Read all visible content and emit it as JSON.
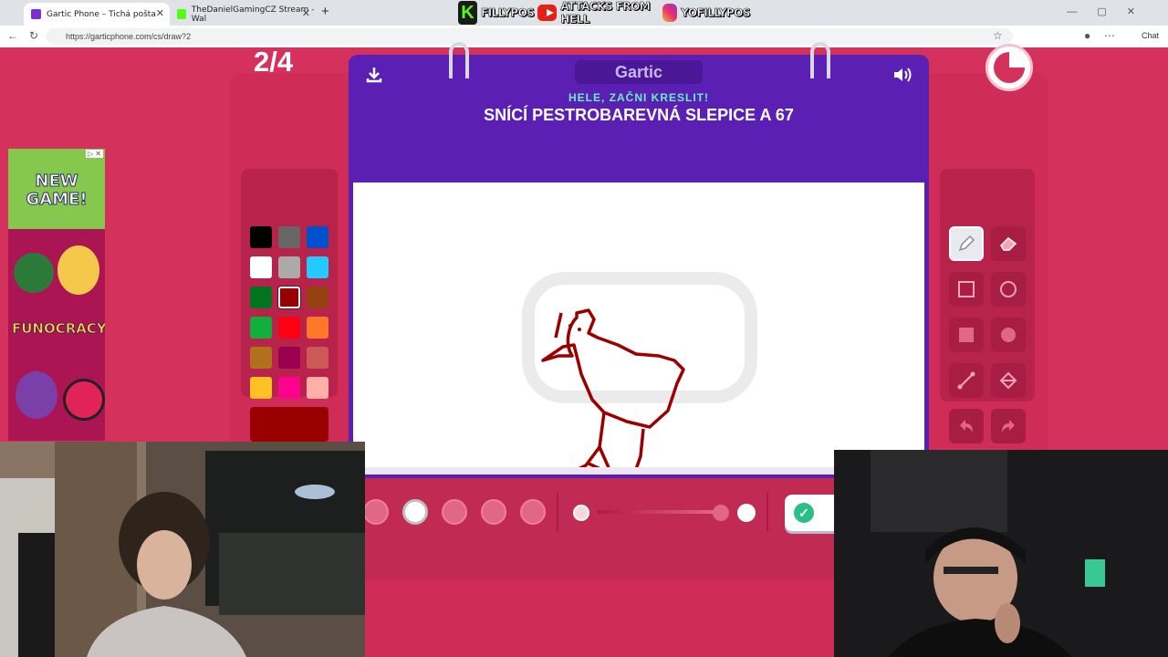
{
  "browser": {
    "tabs": [
      {
        "label": "Gartic Phone – Tichá pošta",
        "close": "✕"
      },
      {
        "label": "TheDanielGamingCZ Stream - Wal",
        "close": "✕"
      }
    ],
    "new_tab": "+",
    "url": "https://garticphone.com/cs/draw?2",
    "chat_label": "Chat",
    "overlay": {
      "kick_label": "FILLYPOS",
      "youtube_label": "ATTACKS FROM HELL",
      "instagram_label": "YOFILLYPOS"
    }
  },
  "game": {
    "round": "2/4",
    "logo": "Gartic",
    "subtitle": "HELE, ZAČNI KRESLIT!",
    "prompt": "SNÍCÍ PESTROBAREVNÁ SLEPICE A 67",
    "timer_remaining_fraction": 0.75,
    "palette": {
      "selected_color": "#9b0000",
      "colors": [
        "#000000",
        "#666666",
        "#0050cd",
        "#ffffff",
        "#aaaaaa",
        "#26c9ff",
        "#017420",
        "#990000",
        "#964112",
        "#11b03c",
        "#ff0013",
        "#ff7829",
        "#b0701c",
        "#99004e",
        "#cb5a57",
        "#ffc126",
        "#ff008f",
        "#feafa8"
      ]
    },
    "tools": [
      "pencil",
      "eraser",
      "rectangle-outline",
      "circle-outline",
      "rectangle-filled",
      "circle-filled",
      "line",
      "fill-bucket",
      "undo",
      "redo"
    ],
    "active_tool": "pencil",
    "brush_sizes_selected": 2,
    "opacity_level": 1.0
  },
  "ad": {
    "title": "NEW GAME!",
    "brand": "FUNOCRACY",
    "close": "▷ ✕"
  },
  "colors": {
    "background": "#d4325c",
    "board": "#5b1fb3",
    "accent_green": "#63f2c2"
  }
}
